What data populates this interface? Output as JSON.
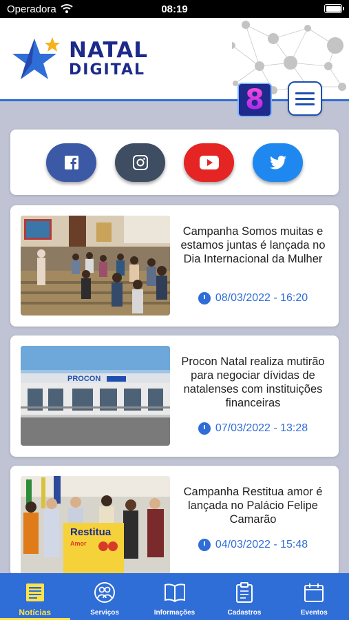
{
  "status_bar": {
    "carrier": "Operadora",
    "time": "08:19"
  },
  "header": {
    "logo_line1": "NATAL",
    "logo_line2": "DIGITAL",
    "badge_text": "8"
  },
  "social": [
    "facebook-icon",
    "instagram-icon",
    "youtube-icon",
    "twitter-icon"
  ],
  "news": [
    {
      "title": "Campanha Somos muitas e estamos juntas é lançada no Dia Internacional da Mulher",
      "date": "08/03/2022 - 16:20"
    },
    {
      "title": "Procon Natal realiza mutirão para negociar dívidas de natalenses com instituições financeiras",
      "date": "07/03/2022 - 13:28"
    },
    {
      "title": "Campanha Restitua amor é lançada no Palácio Felipe Camarão",
      "date": "04/03/2022 - 15:48"
    }
  ],
  "images": {
    "procon_sign": "PROCON",
    "restitua": "Restitua",
    "amor": "Amor"
  },
  "tabs": [
    {
      "label": "Notícias",
      "active": true
    },
    {
      "label": "Serviços"
    },
    {
      "label": "Informações"
    },
    {
      "label": "Cadastros"
    },
    {
      "label": "Eventos"
    }
  ],
  "colors": {
    "primary": "#2f6dd7",
    "accent": "#ffe24a",
    "logo": "#1c2a8a",
    "background": "#bfc3d3"
  }
}
